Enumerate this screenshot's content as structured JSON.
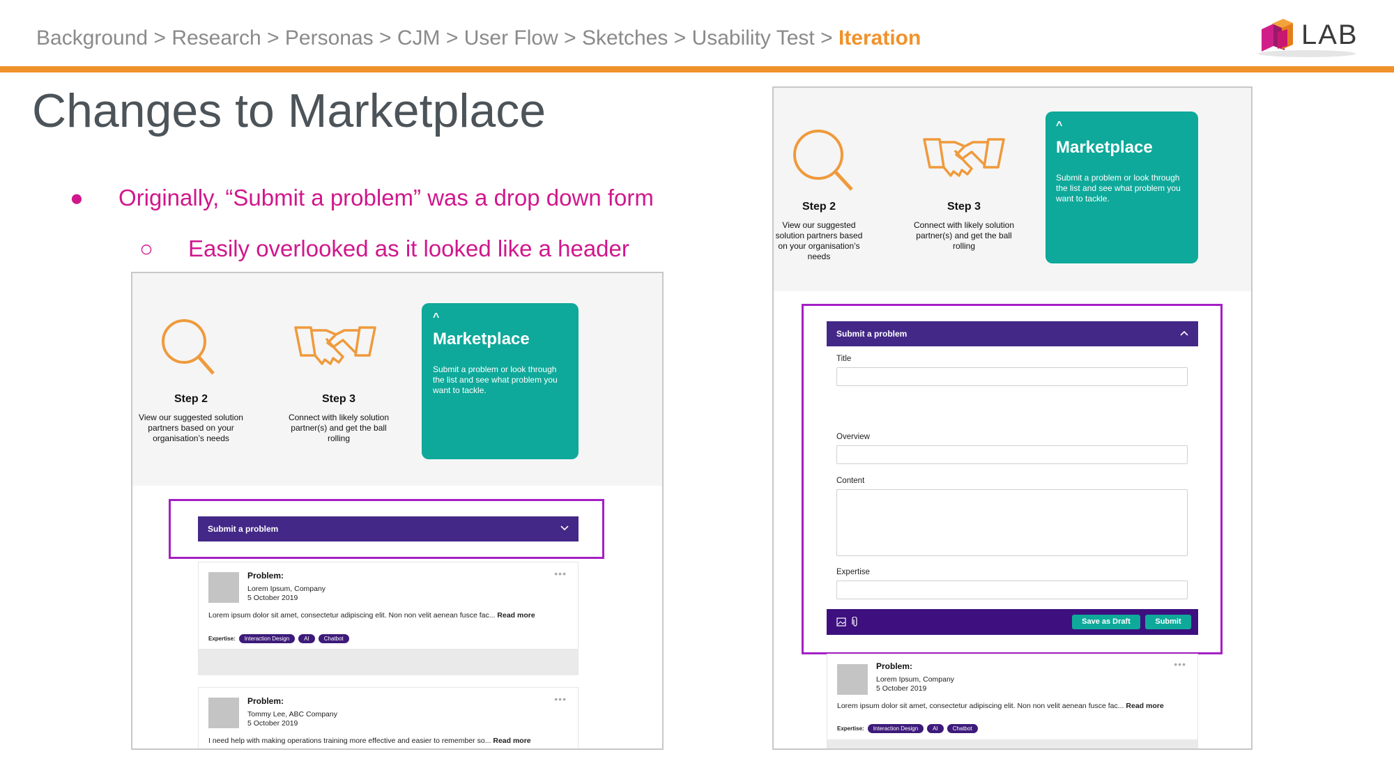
{
  "breadcrumb": {
    "items": [
      "Background",
      "Research",
      "Personas",
      "CJM",
      "User Flow",
      "Sketches",
      "Usability Test"
    ],
    "separator": ">",
    "current": "Iteration"
  },
  "logo": {
    "text": "LAB"
  },
  "title": "Changes to Marketplace",
  "bullets": [
    {
      "marker": "●",
      "text": "Originally, “Submit a problem” was a drop down form"
    },
    {
      "marker": "○",
      "text": "Easily overlooked as it looked like a header"
    }
  ],
  "colors": {
    "accent": "#f0922b",
    "bullet_text": "#d0178c",
    "teal": "#0ea99a",
    "purple": "#432887",
    "highlight": "#a51fc4"
  },
  "left_shot": {
    "step2": {
      "title": "Step 2",
      "desc": "View our suggested solution partners based on your organisation’s needs",
      "icon": "magnifier-icon"
    },
    "step3": {
      "title": "Step 3",
      "desc": "Connect with likely solution partner(s) and get the ball rolling",
      "icon": "handshake-icon"
    },
    "marketplace": {
      "caret": "^",
      "title": "Marketplace",
      "desc": "Submit a problem or look through the list and see what problem you want to tackle."
    },
    "submit_bar": {
      "label": "Submit a problem",
      "icon": "chevron-down-icon"
    },
    "cards": [
      {
        "title": "Problem:",
        "author": "Lorem Ipsum, Company",
        "date": "5 October 2019",
        "body": "Lorem ipsum dolor sit amet, consectetur adipiscing elit. Non non velit aenean fusce fac...",
        "read_more": "Read more",
        "expertise_label": "Expertise:",
        "tags": [
          "Interaction Design",
          "AI",
          "Chatbot"
        ],
        "menu": "•••"
      },
      {
        "title": "Problem:",
        "author": "Tommy Lee, ABC Company",
        "date": "5 October 2019",
        "body": "I need help with making operations training more effective and easier to remember so...",
        "read_more": "Read more",
        "menu": "•••"
      }
    ]
  },
  "right_shot": {
    "step2": {
      "title": "Step 2",
      "desc": "View our suggested solution partners based on your organisation’s needs"
    },
    "step3": {
      "title": "Step 3",
      "desc": "Connect with likely solution partner(s) and get the ball rolling"
    },
    "marketplace": {
      "caret": "^",
      "title": "Marketplace",
      "desc": "Submit a problem or look through the list and see what problem you want to tackle."
    },
    "submit_bar": {
      "label": "Submit a problem",
      "icon": "chevron-up-icon"
    },
    "form": {
      "fields": [
        "Title",
        "Overview",
        "Content",
        "Expertise"
      ],
      "save_draft": "Save as Draft",
      "submit": "Submit",
      "icons": [
        "image-icon",
        "paperclip-icon"
      ]
    },
    "card": {
      "title": "Problem:",
      "author": "Lorem Ipsum, Company",
      "date": "5 October 2019",
      "body": "Lorem ipsum dolor sit amet, consectetur adipiscing elit. Non non velit aenean fusce fac...",
      "read_more": "Read more",
      "expertise_label": "Expertise:",
      "tags": [
        "Interaction Design",
        "AI",
        "Chatbot"
      ],
      "menu": "•••"
    }
  }
}
